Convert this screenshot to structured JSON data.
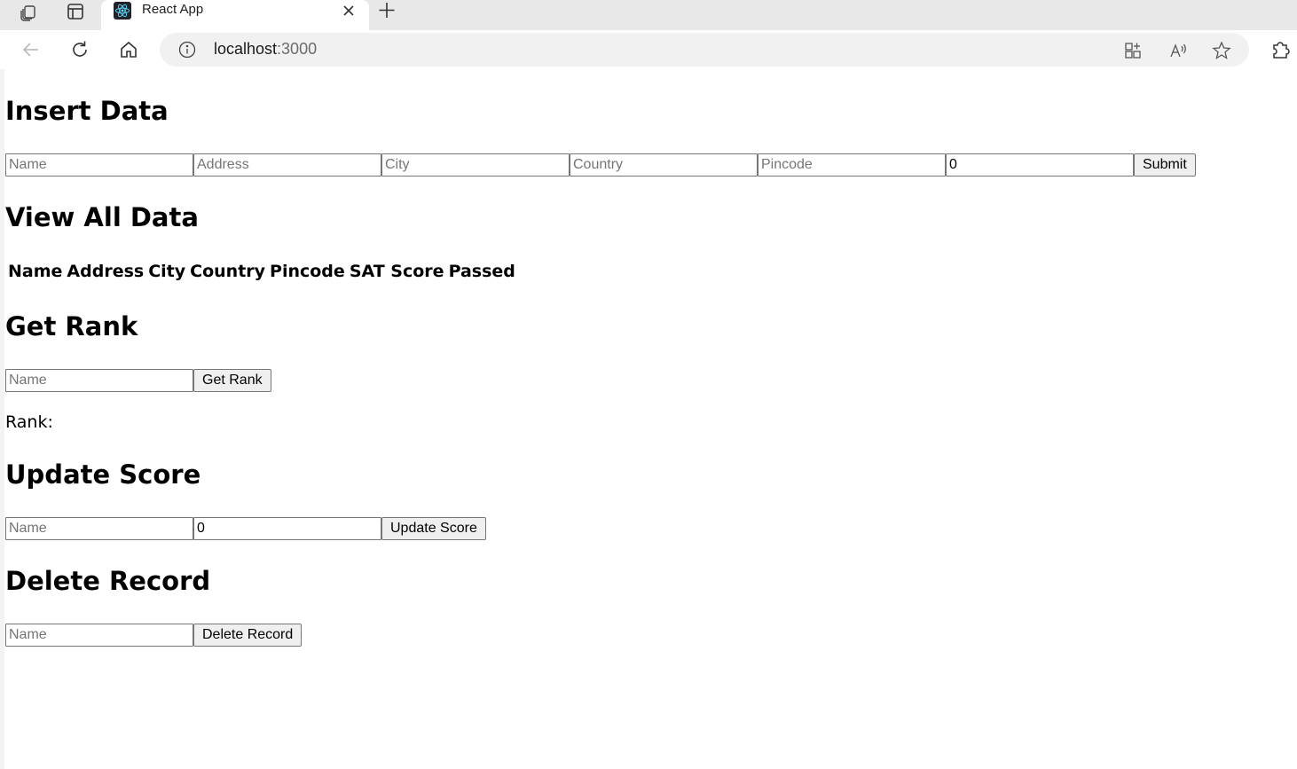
{
  "browser": {
    "tab": {
      "title": "React App"
    },
    "address": {
      "host": "localhost",
      "port": ":3000"
    }
  },
  "insert": {
    "heading": "Insert Data",
    "fields": [
      {
        "placeholder": "Name",
        "value": ""
      },
      {
        "placeholder": "Address",
        "value": ""
      },
      {
        "placeholder": "City",
        "value": ""
      },
      {
        "placeholder": "Country",
        "value": ""
      },
      {
        "placeholder": "Pincode",
        "value": ""
      },
      {
        "placeholder": "",
        "value": "0"
      }
    ],
    "submit_label": "Submit"
  },
  "view": {
    "heading": "View All Data",
    "columns": [
      "Name",
      "Address",
      "City",
      "Country",
      "Pincode",
      "SAT Score",
      "Passed"
    ]
  },
  "rank": {
    "heading": "Get Rank",
    "name_placeholder": "Name",
    "button_label": "Get Rank",
    "result_label": "Rank:",
    "result_value": ""
  },
  "update": {
    "heading": "Update Score",
    "name_placeholder": "Name",
    "score_value": "0",
    "button_label": "Update Score"
  },
  "delete": {
    "heading": "Delete Record",
    "name_placeholder": "Name",
    "button_label": "Delete Record"
  }
}
